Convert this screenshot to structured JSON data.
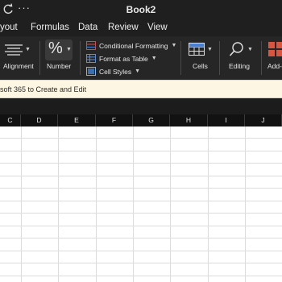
{
  "titlebar": {
    "title": "Book2",
    "more_glyph": "···",
    "icons": [
      "refresh-icon"
    ]
  },
  "menu": {
    "tabs": [
      "yout",
      "Formulas",
      "Data",
      "Review",
      "View"
    ]
  },
  "ribbon": {
    "alignment": "Alignment",
    "number": "Number",
    "number_glyph": "%",
    "conditional_formatting": "Conditional Formatting",
    "format_as_table": "Format as Table",
    "cell_styles": "Cell Styles",
    "cells": "Cells",
    "editing": "Editing",
    "addins": "Add-i"
  },
  "message": {
    "text": "soft 365 to Create and Edit"
  },
  "columns": [
    "C",
    "D",
    "E",
    "F",
    "G",
    "H",
    "I",
    "J"
  ],
  "colors": {
    "titlebar": "#1f1f1f",
    "ribbon": "#262626",
    "message_bg": "#fdf6e3",
    "header": "#121212",
    "gridline": "#dcdcdc"
  }
}
